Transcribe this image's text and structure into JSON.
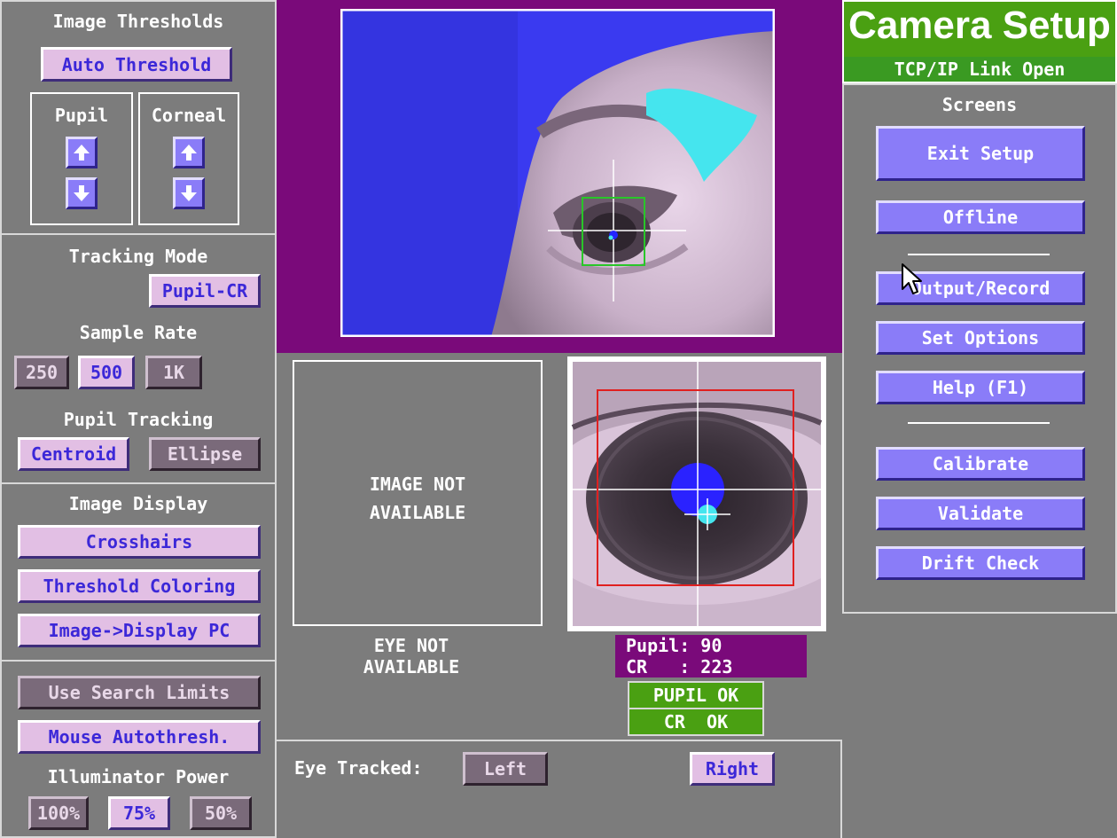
{
  "left": {
    "thresholds": {
      "title": "Image Thresholds",
      "auto": "Auto Threshold",
      "pupil": "Pupil",
      "corneal": "Corneal"
    },
    "tracking": {
      "title": "Tracking Mode",
      "mode": "Pupil-CR",
      "sample_title": "Sample Rate",
      "rates": [
        "250",
        "500",
        "1K"
      ],
      "pupil_title": "Pupil Tracking",
      "centroid": "Centroid",
      "ellipse": "Ellipse"
    },
    "display": {
      "title": "Image Display",
      "crosshairs": "Crosshairs",
      "threshold_coloring": "Threshold Coloring",
      "image_display_pc": "Image->Display PC"
    },
    "misc": {
      "search_limits": "Use Search Limits",
      "mouse_autothresh": "Mouse Autothresh.",
      "illum_title": "Illuminator Power",
      "powers": [
        "100%",
        "75%",
        "50%"
      ]
    }
  },
  "center": {
    "image_na": [
      "IMAGE NOT",
      "AVAILABLE"
    ],
    "eye_na": [
      "EYE NOT",
      "AVAILABLE"
    ],
    "pupil_readout": "Pupil: 90",
    "cr_readout": "CR   : 223",
    "pupil_ok": "PUPIL OK",
    "cr_ok": "CR  OK",
    "eye_tracked_label": "Eye Tracked:",
    "left": "Left",
    "right": "Right"
  },
  "right": {
    "title": "Camera Setup",
    "link": "TCP/IP Link Open",
    "screens_title": "Screens",
    "exit_setup": "Exit Setup",
    "offline": "Offline",
    "output_record": "Output/Record",
    "set_options": "Set Options",
    "help": "Help (F1)",
    "calibrate": "Calibrate",
    "validate": "Validate",
    "drift_check": "Drift Check"
  },
  "colors": {
    "background": "#7c7c7c",
    "selected_button": "#e2bfe4",
    "button_text": "#3c28d8",
    "screen_button": "#8a7cf8",
    "title_green": "#4aa012",
    "camera_frame": "#7a0a7a"
  },
  "icons": {
    "increase": "arrow-up-icon",
    "decrease": "arrow-down-icon",
    "pointer": "mouse-cursor-icon"
  }
}
